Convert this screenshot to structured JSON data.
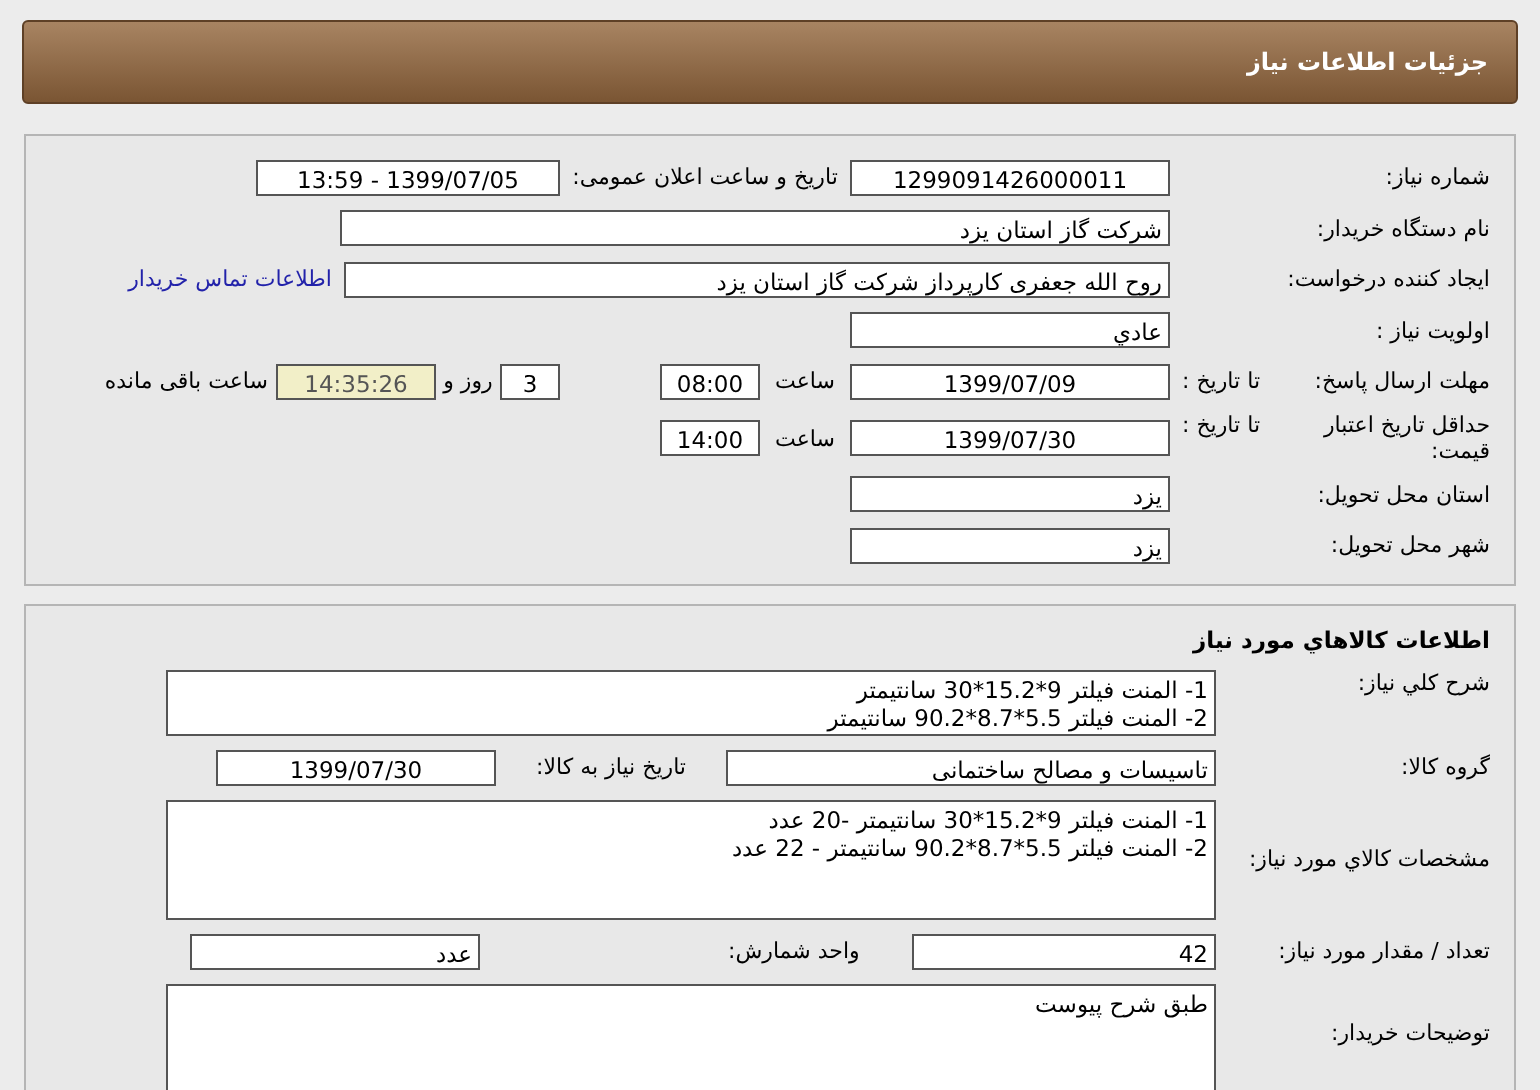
{
  "header": {
    "title": "جزئیات اطلاعات نیاز"
  },
  "need_number": {
    "label": "شماره نیاز:",
    "value": "1299091426000011"
  },
  "announce": {
    "label": "تاریخ و ساعت اعلان عمومی:",
    "value": "1399/07/05 - 13:59"
  },
  "buyer": {
    "label": "نام دستگاه خریدار:",
    "value": "شرکت گاز استان یزد"
  },
  "requester": {
    "label": "ایجاد کننده درخواست:",
    "value": "روح الله جعفری کارپرداز  شرکت گاز استان یزد",
    "contact_link": "اطلاعات تماس خریدار"
  },
  "priority": {
    "label": "اولویت نیاز :",
    "value": "عادي"
  },
  "deadline": {
    "label": "مهلت ارسال پاسخ:",
    "to_label": "تا تاریخ :",
    "date": "1399/07/09",
    "time_label": "ساعت",
    "time": "08:00",
    "days": "3",
    "days_label": "روز و",
    "remaining": "14:35:26",
    "remaining_label": "ساعت باقی مانده"
  },
  "validity": {
    "label": "حداقل تاریخ اعتبار قیمت:",
    "to_label": "تا تاریخ :",
    "date": "1399/07/30",
    "time_label": "ساعت",
    "time": "14:00"
  },
  "province": {
    "label": "استان محل تحویل:",
    "value": "یزد"
  },
  "city": {
    "label": "شهر محل تحویل:",
    "value": "یزد"
  },
  "goods": {
    "title": "اطلاعات کالاهاي مورد نیاز",
    "description": {
      "label": "شرح کلي نیاز:",
      "lines": [
        "1- المنت فیلتر 9*15.2*30 سانتیمتر",
        "2- المنت فیلتر 5.5*8.7*90.2 سانتیمتر"
      ]
    },
    "group": {
      "label": "گروه کالا:",
      "value": "تاسیسات و مصالح ساختمانی"
    },
    "need_date": {
      "label": "تاریخ نیاز به کالا:",
      "value": "1399/07/30"
    },
    "specs": {
      "label": "مشخصات کالاي مورد نیاز:",
      "lines": [
        "1- المنت فیلتر 9*15.2*30 سانتیمتر -20 عدد",
        "2- المنت فیلتر 5.5*8.7*90.2 سانتیمتر - 22 عدد"
      ]
    },
    "quantity": {
      "label": "تعداد / مقدار مورد نیاز:",
      "value": "42"
    },
    "unit": {
      "label": "واحد شمارش:",
      "value": "عدد"
    },
    "notes": {
      "label": "توضیحات خریدار:",
      "value": "طبق شرح پیوست"
    }
  }
}
